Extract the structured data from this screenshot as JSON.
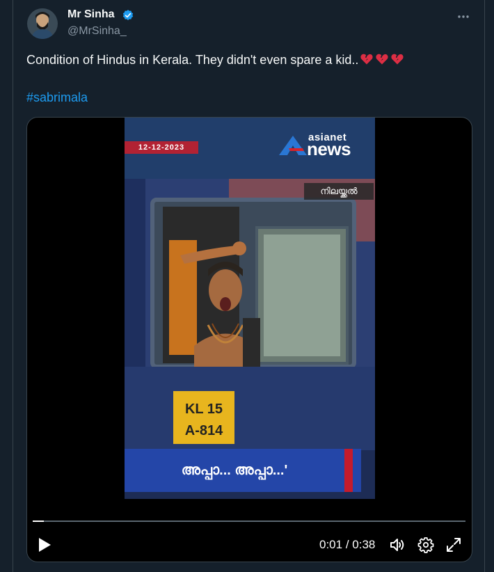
{
  "author": {
    "name": "Mr Sinha",
    "handle": "@MrSinha_",
    "verified": true
  },
  "post": {
    "text": "Condition of Hindus in Kerala. They didn't even spare a kid..",
    "emoji": [
      "broken-heart",
      "broken-heart",
      "broken-heart"
    ],
    "hashtag": "#sabrimala"
  },
  "video": {
    "date_tag": "12-12-2023",
    "logo_top": "asianet",
    "logo_bottom": "news",
    "location_tag": "നിലയ്ക്കൽ",
    "caption": "അപ്പാ... അപ്പാ...'",
    "plate_line1": "KL 15",
    "plate_line2": "A-814",
    "progress": 0.026,
    "time_current": "0:01",
    "time_separator": "/",
    "time_total": "0:38"
  },
  "colors": {
    "background": "#15202b",
    "link": "#1d9bf0",
    "secondary_text": "#8b98a5",
    "caption_bar": "#2446a8"
  }
}
